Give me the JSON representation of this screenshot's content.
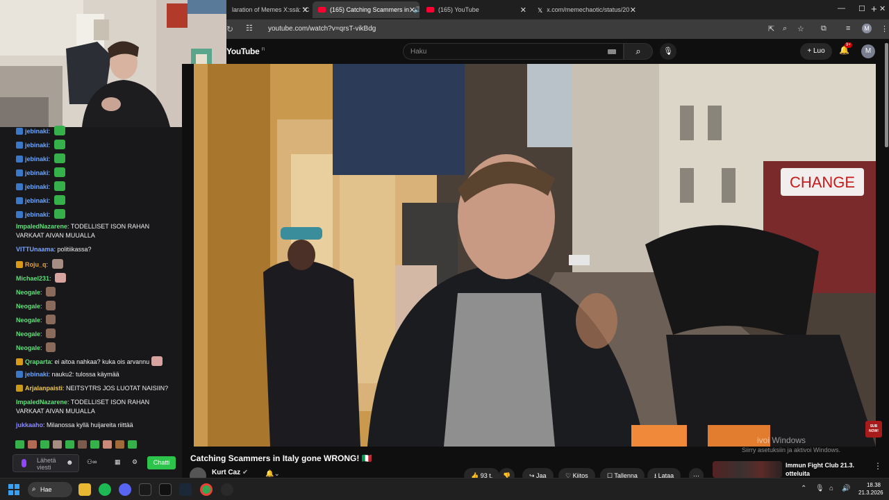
{
  "browser": {
    "tabs": [
      {
        "title": "laration of Memes X:ssä: \"C",
        "active": false
      },
      {
        "title": "(165) Catching Scammers in",
        "active": true
      },
      {
        "title": "(165) YouTube",
        "active": false
      },
      {
        "title": "x.com/memechaotic/status/20",
        "active": false
      }
    ],
    "url": "youtube.com/watch?v=qrsT-vikBdg",
    "profile_letter": "M"
  },
  "youtube": {
    "logo": "YouTube",
    "region": "FI",
    "search_placeholder": "Haku",
    "create_label": "Luo",
    "notif_count": "9+",
    "avatar_letter": "M",
    "video_title": "Catching Scammers in Italy gone WRONG! 🇮🇹",
    "channel_name": "Kurt Caz",
    "likes": "93 t.",
    "actions": {
      "share": "Jaa",
      "thanks": "Kiitos",
      "save": "Tallenna",
      "download": "Lataa"
    },
    "recommended_title": "Immun Fight Club 21.3. otteluita",
    "video_sign": "CHANGE",
    "watermark_line1": "ivoi Windows",
    "watermark_line2": "Siirry asetuksiin ja aktivoi Windows.",
    "sub_badge": "SUB NOW!"
  },
  "chat": {
    "messages": [
      {
        "user": "jebinaki",
        "text": "",
        "emote": "green",
        "color": "#6aa5ff",
        "badge": "#3b78c8"
      },
      {
        "user": "jebinaki",
        "text": "",
        "emote": "green",
        "color": "#6aa5ff",
        "badge": "#3b78c8"
      },
      {
        "user": "jebinaki",
        "text": "",
        "emote": "green",
        "color": "#6aa5ff",
        "badge": "#3b78c8"
      },
      {
        "user": "jebinaki",
        "text": "",
        "emote": "green",
        "color": "#6aa5ff",
        "badge": "#3b78c8"
      },
      {
        "user": "jebinaki",
        "text": "",
        "emote": "green",
        "color": "#6aa5ff",
        "badge": "#3b78c8"
      },
      {
        "user": "jebinaki",
        "text": "",
        "emote": "green",
        "color": "#6aa5ff",
        "badge": "#3b78c8"
      },
      {
        "user": "jebinaki",
        "text": "",
        "emote": "green",
        "color": "#6aa5ff",
        "badge": "#3b78c8"
      },
      {
        "user": "ImpaledNazarene",
        "text": "TODELLISET ISON RAHAN VARKAAT AIVAN MUUALLA",
        "emote": "",
        "color": "#5ee07a",
        "badge": ""
      },
      {
        "user": "VITTUnaama",
        "text": "politiikassa?",
        "emote": "",
        "color": "#7aa4ff",
        "badge": ""
      },
      {
        "user": "Roju_q",
        "text": "",
        "emote": "cat",
        "color": "#e6a23a",
        "badge": "#d99a18"
      },
      {
        "user": "Michael231",
        "text": "",
        "emote": "pink",
        "color": "#5ee07a",
        "badge": ""
      },
      {
        "user": "Neogale",
        "text": "",
        "emote": "face",
        "color": "#5ee07a",
        "badge": ""
      },
      {
        "user": "Neogale",
        "text": "",
        "emote": "face",
        "color": "#5ee07a",
        "badge": ""
      },
      {
        "user": "Neogale",
        "text": "",
        "emote": "face",
        "color": "#5ee07a",
        "badge": ""
      },
      {
        "user": "Neogale",
        "text": "",
        "emote": "face",
        "color": "#5ee07a",
        "badge": ""
      },
      {
        "user": "Neogale",
        "text": "",
        "emote": "face",
        "color": "#5ee07a",
        "badge": ""
      },
      {
        "user": "Qraparta",
        "text": "ei aitoa nahkaa? kuka ois arvannu",
        "emote": "pink",
        "color": "#5ee07a",
        "badge": "#d99a18"
      },
      {
        "user": "jebinaki",
        "text": "nauku2: tulossa käymää",
        "emote": "",
        "color": "#6aa5ff",
        "badge": "#3b78c8"
      },
      {
        "user": "Arjalanpaisti",
        "text": "NEITSYTRS JOS LUOTAT NAISIIN?",
        "emote": "",
        "color": "#f0c84a",
        "badge": "#c89a18"
      },
      {
        "user": "ImpaledNazarene",
        "text": "TODELLISET ISON RAHAN VARKAAT AIVAN MUUALLA",
        "emote": "",
        "color": "#5ee07a",
        "badge": ""
      },
      {
        "user": "jukkaaho",
        "text": "Milanossa kyllä huijareita riittää",
        "emote": "",
        "color": "#8a8aff",
        "badge": ""
      }
    ],
    "input_placeholder": "Lähetä viesti",
    "send_label": "Chatti"
  },
  "taskbar": {
    "search_label": "Hae",
    "time": "18.38",
    "date": "21.3.2026"
  }
}
